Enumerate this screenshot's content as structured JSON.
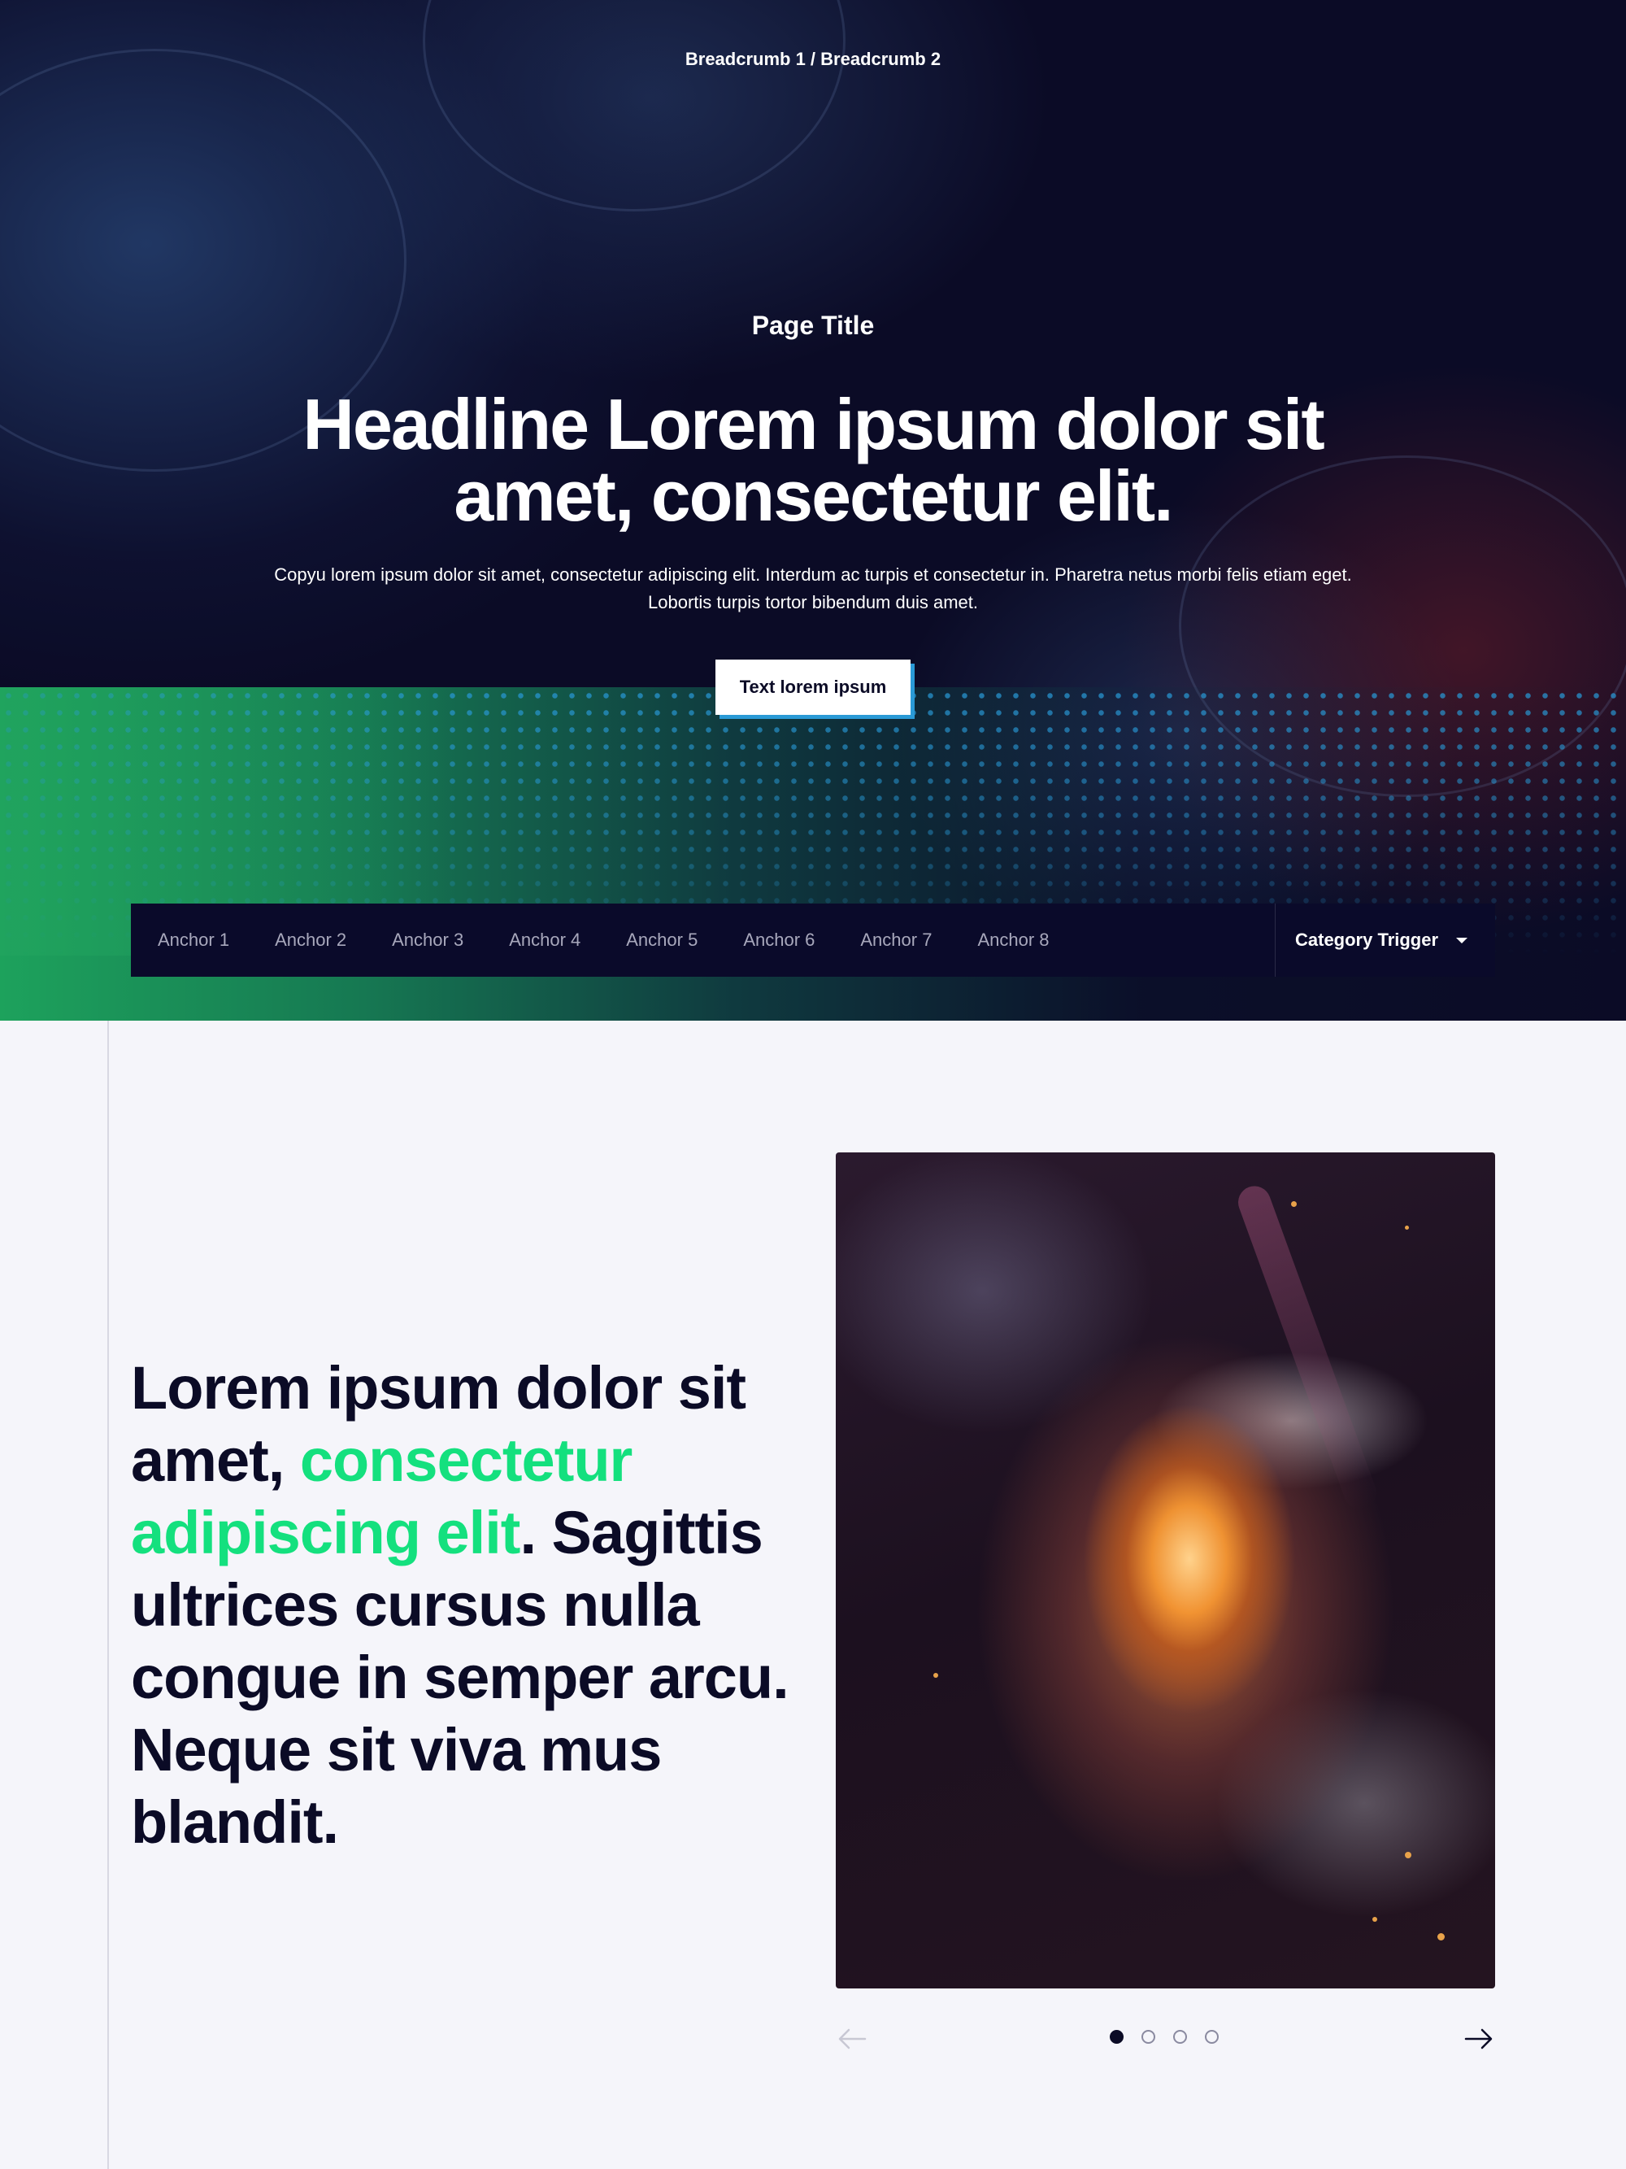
{
  "hero": {
    "breadcrumb": "Breadcrumb 1 / Breadcrumb 2",
    "page_title": "Page Title",
    "headline": "Headline Lorem ipsum dolor sit amet, consectetur elit.",
    "copy": "Copyu lorem ipsum dolor sit amet, consectetur adipiscing elit. Interdum ac turpis et consectetur in. Pharetra netus morbi felis etiam eget. Lobortis turpis tortor bibendum duis amet.",
    "cta_label": "Text lorem ipsum"
  },
  "anchor_nav": {
    "items": [
      "Anchor 1",
      "Anchor 2",
      "Anchor 3",
      "Anchor 4",
      "Anchor 5",
      "Anchor 6",
      "Anchor 7",
      "Anchor 8"
    ],
    "category_trigger": "Category Trigger"
  },
  "content": {
    "lead_part1": "Lorem ipsum dolor sit amet, ",
    "lead_accent": "consectetur adipiscing elit",
    "lead_part2": ". Sagittis ultrices cursus nulla congue in semper arcu. Neque sit viva mus blandit."
  },
  "carousel": {
    "slide_count": 4,
    "active_slide": 1,
    "prev_icon": "arrow-left-icon",
    "next_icon": "arrow-right-icon"
  },
  "colors": {
    "navy": "#0b0b26",
    "accent_green": "#14e07e",
    "button_shadow_blue": "#2a9ad6",
    "background": "#f5f5fa"
  }
}
